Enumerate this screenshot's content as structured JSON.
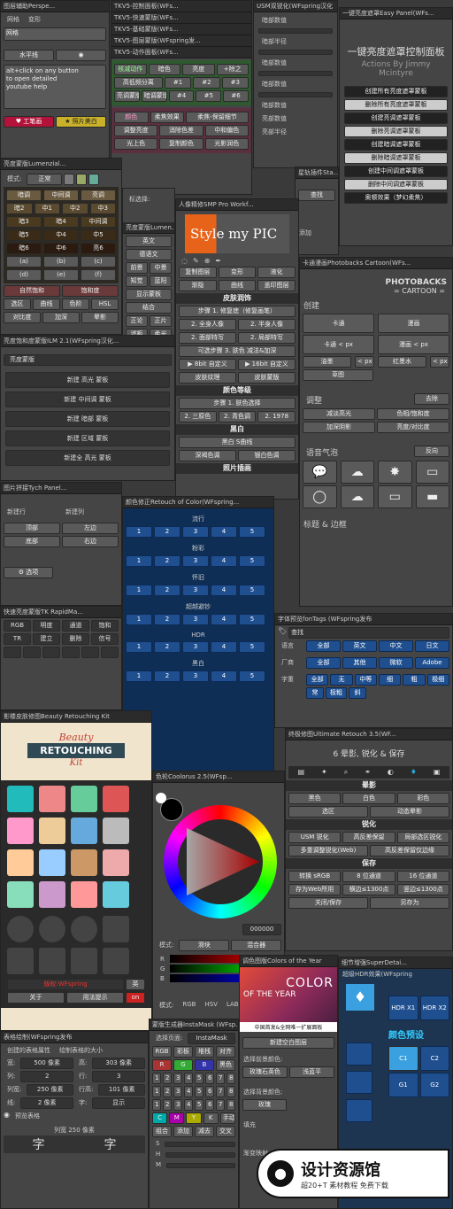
{
  "p1": {
    "title": "图层辅助Perspe...",
    "tabs": [
      "网格",
      "变形"
    ],
    "r1": "网格",
    "r2": "水平线",
    "help": "alt+click on any button\nto open detailed\nyoutube help",
    "b1": "工笔画",
    "b2": "照片美白"
  },
  "p2": {
    "title": "TKV5-控制面板(WFs...",
    "rows": [
      "TKV5-快速蒙版(WFs...",
      "TKV5-基础蒙版(WFs...",
      "TKV5-图层蒙版(WFspring发...",
      "TKV5-动作面板(WFs..."
    ],
    "btns": [
      [
        "核减动作",
        "暗色",
        "亮度",
        "+除之"
      ],
      [
        "高低频分离",
        "#1",
        "#2",
        "#3"
      ],
      [
        "亮调蒙版",
        "暗调蒙版",
        "#4",
        "#5",
        "#6"
      ],
      [
        "颜色",
        "柔焦效果",
        "柔焦-保留细节"
      ],
      [
        "调整亮度",
        "消除色差",
        "中和偏色"
      ],
      [
        "光上色",
        "复制颜色",
        "光影润色"
      ]
    ]
  },
  "p3": {
    "title": "USM双锐化(WFspring汉化",
    "items": [
      "暗部数值",
      "暗部半径",
      "暗部数值",
      "暗部数值",
      "暗部数值",
      "亮部数值",
      "亮部半径"
    ]
  },
  "p4": {
    "title": "一键亮度遮罩Easy Panel(WFs...",
    "heading": "一键亮度遮罩控制面板",
    "sub": "Actions By Jimmy\nMcintyre",
    "btns": [
      "创建所有亮度遮罩蒙板",
      "删除所有亮度遮罩蒙板",
      "创建亮调遮罩蒙板",
      "删除亮调遮罩蒙板",
      "创建暗调遮罩蒙板",
      "删除暗调遮罩蒙板",
      "创建中间调遮罩蒙板",
      "删除中间调遮罩蒙板",
      "奥顿效果（梦幻柔焦）"
    ]
  },
  "p5": {
    "title": "亮度蒙版Lumenzial...",
    "mode": "模式:",
    "mode_val": "正常",
    "grid": [
      [
        "暗调",
        "中间调",
        "亮调"
      ],
      [
        "暗2",
        "中1",
        "中2",
        "中3"
      ],
      [
        "暗3",
        "暗4",
        "中间调"
      ],
      [
        "暗5",
        "中4",
        "中5"
      ],
      [
        "暗6",
        "中6",
        "亮6"
      ],
      [
        "(a)",
        "(b)",
        "(c)"
      ],
      [
        "(d)",
        "(e)",
        "(f)"
      ]
    ],
    "bottom": [
      [
        "自然饱和",
        "饱和度"
      ],
      [
        "选区",
        "曲线",
        "色阶",
        "HSL"
      ],
      [
        "对比度",
        "加深",
        "晕影"
      ]
    ]
  },
  "p6": {
    "title": "亮度饱和度蒙版ILM 2.1(WFspring汉化...",
    "select": "亮度蒙版",
    "btns": [
      "新建 高光 蒙板",
      "新建 中间调 蒙板",
      "新建 暗部 蒙板",
      "新建 区域 蒙板",
      "新建全 高光 蒙板"
    ]
  },
  "p7": {
    "title": "星轨插件Sta...",
    "r1": "查找",
    "r2": "添加"
  },
  "p8": {
    "title": "人像精修SMP Pro Workf...",
    "logo": "Style my PIC",
    "btns": [
      [
        "复制图层",
        "变形",
        "液化"
      ],
      [
        "渐隐",
        "曲线",
        "盖印图层"
      ]
    ],
    "s1": "皮肤润饰",
    "r1": "步骤 1. 修复痣（修复画笔）",
    "r2": [
      "2. 全身人像",
      "2. 半身人像"
    ],
    "r3": [
      "2. 面部特写",
      "2. 局部特写"
    ],
    "r4": "可选步骤 3. 肤色 减法&加深",
    "r5": [
      "▶ 8bit 自定义",
      "▶ 16bit 自定义"
    ],
    "r6": [
      "皮肤纹理",
      "皮肤蒙版"
    ],
    "s2": "颜色等级",
    "r7": "步骤 1. 肤色选择",
    "r8": [
      "2. 三原色",
      "2. 青色调",
      "2. 1978"
    ],
    "s3": "黑白",
    "r9": "黑白 S曲线",
    "r10": [
      "深褐色调",
      "银白色调"
    ],
    "s4": "照片插画"
  },
  "p9": {
    "title": "亮度蒙版Lumen...",
    "tb": "标选择:",
    "tbv": "固定",
    "btns": [
      [
        "英文"
      ],
      [
        "德语文"
      ],
      [
        "前景",
        "中景"
      ],
      [
        "知觉",
        "蓝阳"
      ],
      [
        "显示蒙板"
      ],
      [
        "结合"
      ],
      [
        "正论",
        "正片"
      ],
      [
        "滤板",
        "柔光"
      ]
    ]
  },
  "p10": {
    "title": "卡通漫画Photobacks Cartoon(WFs...",
    "logo1": "PHOTOBACKS",
    "logo2": "= CARTOON =",
    "create": "创建",
    "b": [
      [
        "卡通",
        "漫画"
      ],
      [
        "卡通 < px",
        "漫画 < px"
      ],
      [
        "油墨",
        "< px",
        "红墨水",
        "< px"
      ],
      [
        "草图"
      ]
    ],
    "adjust": "调整",
    "rm": "去除",
    "adj": [
      [
        "减淡高光",
        "色相/饱和度"
      ],
      [
        "加深阴影",
        "亮度/对比度"
      ]
    ],
    "speech": "语音气泡",
    "rev": "反向",
    "title_b": "标题 & 边框"
  },
  "p11": {
    "title": "图片拼接Tych Panel...",
    "l1": "新建行",
    "l2": "新建列",
    "b": [
      [
        "顶部",
        "左边"
      ],
      [
        "底部",
        "右边"
      ]
    ],
    "opt": "选项"
  },
  "p12": {
    "title": "颜色修正Retouch of Color(WFspring...",
    "secs": [
      "流行",
      "粉彩",
      "怀旧",
      "超越避钞",
      "HDR",
      "黑白"
    ],
    "nums": [
      "1",
      "2",
      "3",
      "4",
      "5"
    ]
  },
  "p13": {
    "title": "快速亮度蒙版TK RapidMa...",
    "labels": [
      "RGB",
      "明度",
      "通道",
      "饱和",
      "TR",
      "建立",
      "删除",
      "信号"
    ]
  },
  "p14": {
    "title": "字体预览fonTags (WFspring发布",
    "search": "查找",
    "lang": "语言",
    "fac": "厂商",
    "wt": "字重",
    "l": [
      "全部",
      "英文",
      "中文",
      "日文"
    ],
    "f": [
      "全部",
      "其他",
      "微软",
      "Adobe"
    ],
    "w": [
      "全部",
      "无",
      "中等",
      "细",
      "粗",
      "极细",
      "常",
      "极粗",
      "斜"
    ]
  },
  "p15": {
    "title": "影楼皮肤修图Beauty Retouching Kit",
    "badge1": "Beauty",
    "badge2": "RETOUCHING",
    "badge3": "Kit",
    "b1": "版权:WFspring",
    "b2": "英",
    "b3": "关于",
    "b4": "用法提示",
    "b5": "on"
  },
  "p16": {
    "title": "终极修图Ultimate Retouch 3.5(WF...",
    "sub": "6 晕影, 锐化 & 保存",
    "s1": "晕影",
    "r1": [
      "黑色",
      "白色",
      "彩色"
    ],
    "r2": [
      "选区",
      "动态晕影"
    ],
    "s2": "锐化",
    "r3": [
      "USM 锐化",
      "高反差保留",
      "局部选区锐化"
    ],
    "r4": [
      "多重调整锐化(Web)",
      "高反差保留仅边缘"
    ],
    "s3": "保存",
    "r5": [
      "转换 sRGB",
      "8 位通道",
      "16 位通道"
    ],
    "r6": [
      "存为Web所用",
      "横边≤1300点",
      "竖边≤1300点"
    ],
    "r7": [
      "关闭/保存",
      "另存为"
    ]
  },
  "p17": {
    "title": "色轮Coolorus 2.5(WFsp...",
    "mode": "模式:",
    "m1": "滑块",
    "m2": "混合器",
    "hex": "000000",
    "tabs": [
      "模式:",
      "RGB",
      "HSV",
      "LAB"
    ],
    "rgb": [
      "R",
      "G",
      "B"
    ]
  },
  "p18": {
    "title": "调色图版Colors of the Year",
    "l1": "COLOR",
    "l2": "OF THE YEAR",
    "foot": "中国首发&全网唯一扩展面板",
    "new": "新建空白图层",
    "s1": "选择前景颜色:",
    "c": [
      "玫瑰石英色",
      "浅蓝平"
    ],
    "s2": "选择背景颜色:",
    "c2": "玫瑰",
    "fill": "填充",
    "mode": "渐变映射:"
  },
  "p19": {
    "title": "细节增强SuperDetai...",
    "sub": "超级HDR效果(WFspring",
    "b": [
      "HDR X1",
      "HDR X2"
    ],
    "pre": "颜色预设",
    "c": [
      "C1",
      "C2",
      "G1",
      "G2"
    ]
  },
  "p20": {
    "title": "表格绘制(WFspring发布",
    "prop": "创建的表格属性",
    "draw": "绘制表格的大小",
    "w": "宽:",
    "wv": "500 像素",
    "h": "高:",
    "hv": "303 像素",
    "col": "列:",
    "cv": "2",
    "row": "行:",
    "rv": "3",
    "cs": "列宽:",
    "csv": "250 像素",
    "rh": "行高:",
    "rhv": "101 像素",
    "ln": "线:",
    "lnv": "2 像素",
    "show": "字:",
    "showv": "显示",
    "preview": "预览表格",
    "pw": "列宽 250 像素",
    "chars": [
      "字",
      "字"
    ]
  },
  "p21": {
    "title": "蒙版生成器InstaMask (WFsp...",
    "pg": "选择页面:",
    "pgv": "InstaMask",
    "rgb": [
      "RGB",
      "彩板",
      "堆栈",
      "对齐",
      "黑白"
    ],
    "ch": [
      "R",
      "G",
      "B",
      "黑色"
    ],
    "nums": [
      "1",
      "2",
      "3",
      "4",
      "5",
      "6",
      "7",
      "8"
    ],
    "cmyk": [
      "C",
      "M",
      "Y",
      "K",
      "手动"
    ],
    "ops": [
      "组合",
      "添加",
      "减去",
      "交叉"
    ],
    "sl": [
      "S",
      "H",
      "M"
    ]
  },
  "wm": {
    "t": "设计资源馆",
    "s": "超20+T 素材教程 免费下载"
  }
}
